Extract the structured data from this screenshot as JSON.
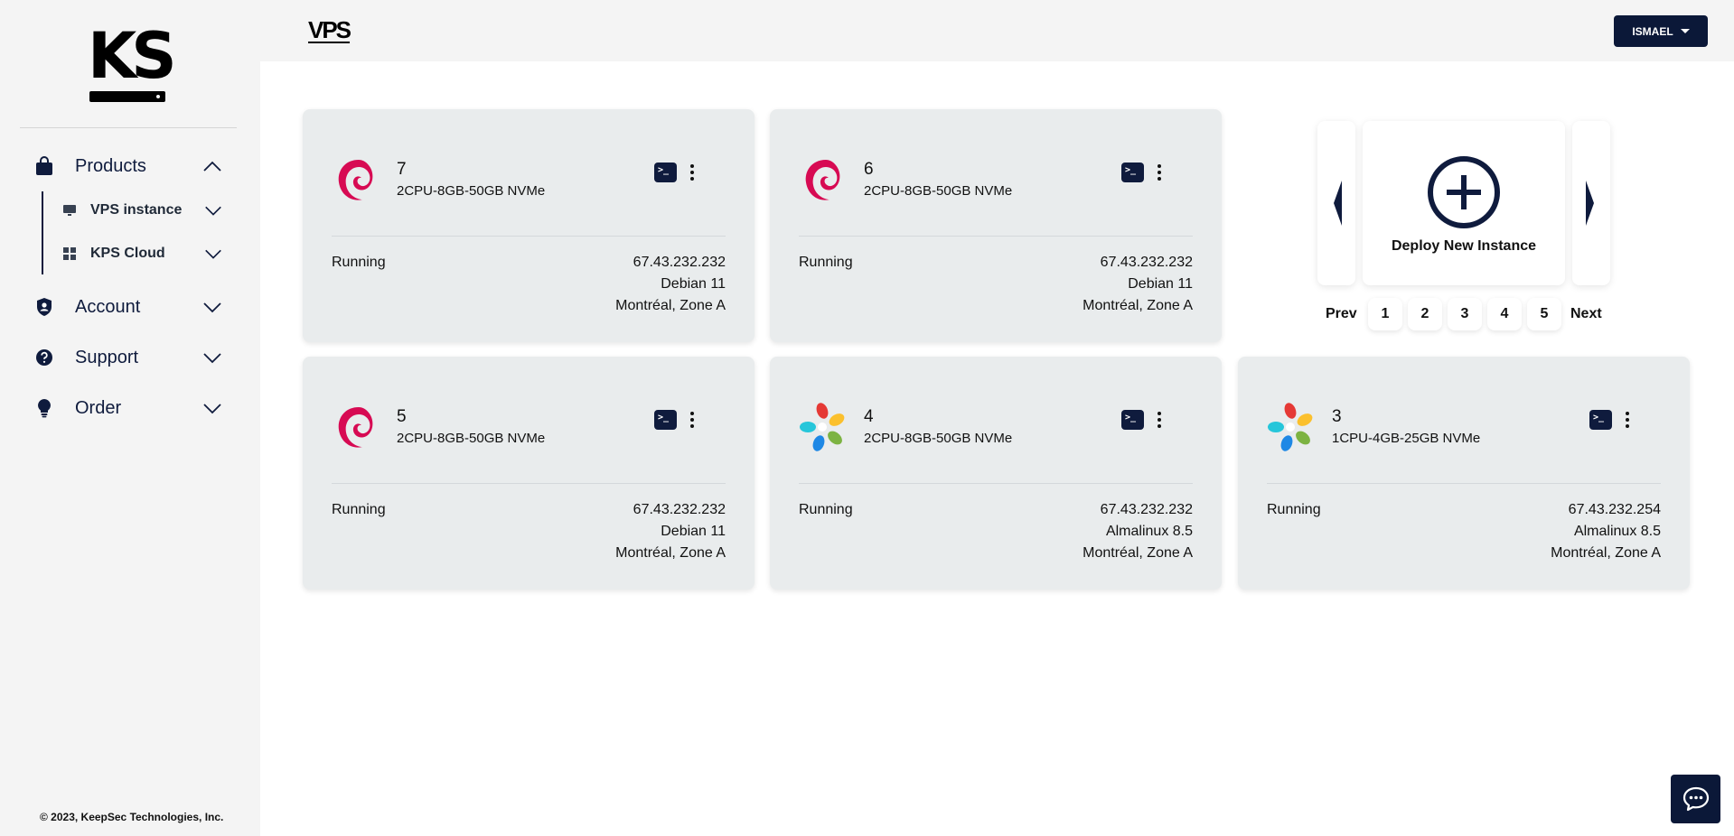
{
  "sidebar": {
    "logo_text": "KS",
    "items": [
      {
        "label": "Products",
        "expanded": true
      },
      {
        "label": "Account",
        "expanded": false
      },
      {
        "label": "Support",
        "expanded": false
      },
      {
        "label": "Order",
        "expanded": false
      }
    ],
    "sub_items": [
      {
        "label": "VPS instance"
      },
      {
        "label": "KPS Cloud"
      }
    ],
    "copyright": "© 2023, KeepSec Technologies, Inc."
  },
  "header": {
    "title": "VPS",
    "user_label": "ISMAEL"
  },
  "instances": [
    {
      "id": "7",
      "plan": "2CPU-8GB-50GB NVMe",
      "status": "Running",
      "ip": "67.43.232.232",
      "os": "Debian 11",
      "location": "Montréal, Zone A",
      "os_icon": "debian-icon"
    },
    {
      "id": "6",
      "plan": "2CPU-8GB-50GB NVMe",
      "status": "Running",
      "ip": "67.43.232.232",
      "os": "Debian 11",
      "location": "Montréal, Zone A",
      "os_icon": "debian-icon"
    },
    {
      "id": "5",
      "plan": "2CPU-8GB-50GB NVMe",
      "status": "Running",
      "ip": "67.43.232.232",
      "os": "Debian 11",
      "location": "Montréal, Zone A",
      "os_icon": "debian-icon"
    },
    {
      "id": "4",
      "plan": "2CPU-8GB-50GB NVMe",
      "status": "Running",
      "ip": "67.43.232.232",
      "os": "Almalinux 8.5",
      "location": "Montréal, Zone A",
      "os_icon": "almalinux-icon"
    },
    {
      "id": "3",
      "plan": "1CPU-4GB-25GB NVMe",
      "status": "Running",
      "ip": "67.43.232.254",
      "os": "Almalinux 8.5",
      "location": "Montréal, Zone A",
      "os_icon": "almalinux-icon"
    }
  ],
  "deploy": {
    "label": "Deploy New Instance"
  },
  "pagination": {
    "prev": "Prev",
    "next": "Next",
    "pages": [
      "1",
      "2",
      "3",
      "4",
      "5"
    ]
  },
  "colors": {
    "navy": "#0b1838",
    "card_bg": "#e9eced",
    "debian_red": "#d70a53"
  }
}
